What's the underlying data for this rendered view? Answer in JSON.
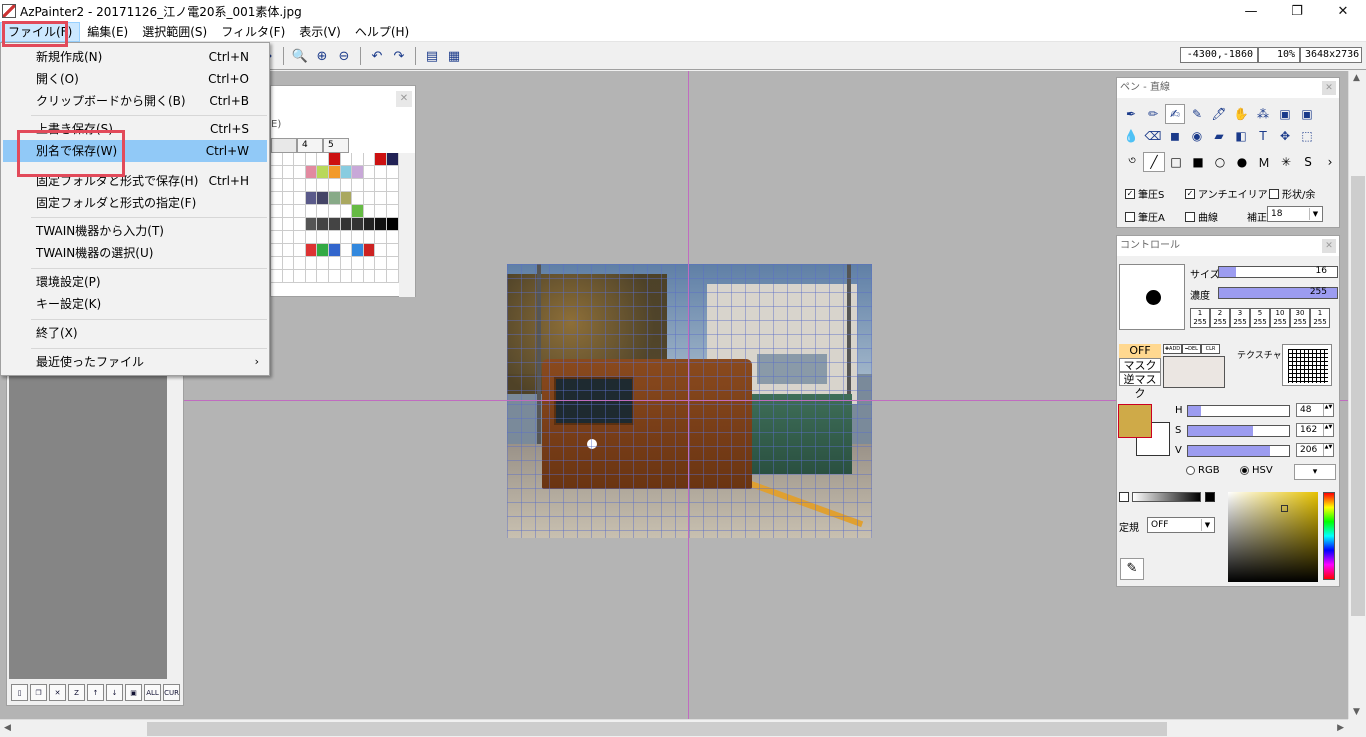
{
  "window": {
    "title": "AzPainter2 - 20171126_江ノ電20系_001素体.jpg",
    "minimize": "—",
    "maximize": "❐",
    "close": "✕"
  },
  "menubar": [
    "ファイル(F)",
    "編集(E)",
    "選択範囲(S)",
    "フィルタ(F)",
    "表示(V)",
    "ヘルプ(H)"
  ],
  "status": {
    "coords": "-4300,-1860",
    "zoom": "10%",
    "size": "3648x2736"
  },
  "file_menu": {
    "items": [
      {
        "label": "新規作成(N)",
        "shortcut": "Ctrl+N"
      },
      {
        "label": "開く(O)",
        "shortcut": "Ctrl+O"
      },
      {
        "label": "クリップボードから開く(B)",
        "shortcut": "Ctrl+B"
      },
      {
        "label": "上書き保存(S)",
        "shortcut": "Ctrl+S"
      },
      {
        "label": "別名で保存(W)",
        "shortcut": "Ctrl+W"
      },
      {
        "label": "固定フォルダと形式で保存(H)",
        "shortcut": "Ctrl+H"
      },
      {
        "label": "固定フォルダと形式の指定(F)",
        "shortcut": ""
      },
      {
        "label": "TWAIN機器から入力(T)",
        "shortcut": ""
      },
      {
        "label": "TWAIN機器の選択(U)",
        "shortcut": ""
      },
      {
        "label": "環境設定(P)",
        "shortcut": ""
      },
      {
        "label": "キー設定(K)",
        "shortcut": ""
      },
      {
        "label": "終了(X)",
        "shortcut": ""
      },
      {
        "label": "最近使ったファイル",
        "shortcut": ""
      }
    ],
    "highlighted": "別名で保存(W)"
  },
  "palette": {
    "label": "E)",
    "tabs": [
      "4",
      "5"
    ],
    "close": "✕"
  },
  "pen_panel": {
    "title": "ペン - 直線",
    "checks": {
      "pressure_s": "筆圧S",
      "antialias": "アンチエイリアス",
      "shape_tail": "形状/余",
      "pressure_a": "筆圧A",
      "curve": "曲線",
      "correction": "補正"
    },
    "correction_value": "18"
  },
  "control_panel": {
    "title": "コントロール",
    "size_label": "サイズ",
    "size_value": "16",
    "density_label": "濃度",
    "density_value": "255",
    "presets": [
      [
        "1",
        "255"
      ],
      [
        "2",
        "255"
      ],
      [
        "3",
        "255"
      ],
      [
        "5",
        "255"
      ],
      [
        "10",
        "255"
      ],
      [
        "30",
        "255"
      ],
      [
        "1",
        "255"
      ]
    ],
    "off_label": "OFF",
    "mask_label": "マスク",
    "reverse_mask_label": "逆マスク",
    "mask_buttons": [
      "✚ADD",
      "━DEL",
      "CLR"
    ],
    "texture_label": "テクスチャ",
    "h_label": "H",
    "h_value": "48",
    "s_label": "S",
    "s_value": "162",
    "v_label": "V",
    "v_value": "206",
    "rgb_label": "RGB",
    "hsv_label": "HSV",
    "rule_label": "定規",
    "rule_value": "OFF",
    "fg_color": "#cfaa48"
  }
}
